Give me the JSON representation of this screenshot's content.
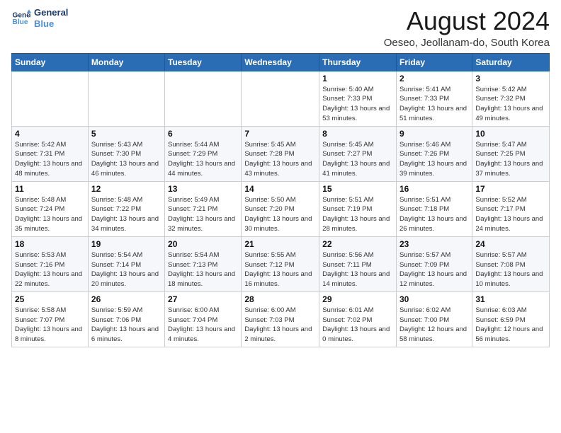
{
  "header": {
    "logo_line1": "General",
    "logo_line2": "Blue",
    "month_title": "August 2024",
    "subtitle": "Oeseo, Jeollanam-do, South Korea"
  },
  "weekdays": [
    "Sunday",
    "Monday",
    "Tuesday",
    "Wednesday",
    "Thursday",
    "Friday",
    "Saturday"
  ],
  "weeks": [
    [
      {
        "day": "",
        "sunrise": "",
        "sunset": "",
        "daylight": ""
      },
      {
        "day": "",
        "sunrise": "",
        "sunset": "",
        "daylight": ""
      },
      {
        "day": "",
        "sunrise": "",
        "sunset": "",
        "daylight": ""
      },
      {
        "day": "",
        "sunrise": "",
        "sunset": "",
        "daylight": ""
      },
      {
        "day": "1",
        "sunrise": "Sunrise: 5:40 AM",
        "sunset": "Sunset: 7:33 PM",
        "daylight": "Daylight: 13 hours and 53 minutes."
      },
      {
        "day": "2",
        "sunrise": "Sunrise: 5:41 AM",
        "sunset": "Sunset: 7:33 PM",
        "daylight": "Daylight: 13 hours and 51 minutes."
      },
      {
        "day": "3",
        "sunrise": "Sunrise: 5:42 AM",
        "sunset": "Sunset: 7:32 PM",
        "daylight": "Daylight: 13 hours and 49 minutes."
      }
    ],
    [
      {
        "day": "4",
        "sunrise": "Sunrise: 5:42 AM",
        "sunset": "Sunset: 7:31 PM",
        "daylight": "Daylight: 13 hours and 48 minutes."
      },
      {
        "day": "5",
        "sunrise": "Sunrise: 5:43 AM",
        "sunset": "Sunset: 7:30 PM",
        "daylight": "Daylight: 13 hours and 46 minutes."
      },
      {
        "day": "6",
        "sunrise": "Sunrise: 5:44 AM",
        "sunset": "Sunset: 7:29 PM",
        "daylight": "Daylight: 13 hours and 44 minutes."
      },
      {
        "day": "7",
        "sunrise": "Sunrise: 5:45 AM",
        "sunset": "Sunset: 7:28 PM",
        "daylight": "Daylight: 13 hours and 43 minutes."
      },
      {
        "day": "8",
        "sunrise": "Sunrise: 5:45 AM",
        "sunset": "Sunset: 7:27 PM",
        "daylight": "Daylight: 13 hours and 41 minutes."
      },
      {
        "day": "9",
        "sunrise": "Sunrise: 5:46 AM",
        "sunset": "Sunset: 7:26 PM",
        "daylight": "Daylight: 13 hours and 39 minutes."
      },
      {
        "day": "10",
        "sunrise": "Sunrise: 5:47 AM",
        "sunset": "Sunset: 7:25 PM",
        "daylight": "Daylight: 13 hours and 37 minutes."
      }
    ],
    [
      {
        "day": "11",
        "sunrise": "Sunrise: 5:48 AM",
        "sunset": "Sunset: 7:24 PM",
        "daylight": "Daylight: 13 hours and 35 minutes."
      },
      {
        "day": "12",
        "sunrise": "Sunrise: 5:48 AM",
        "sunset": "Sunset: 7:22 PM",
        "daylight": "Daylight: 13 hours and 34 minutes."
      },
      {
        "day": "13",
        "sunrise": "Sunrise: 5:49 AM",
        "sunset": "Sunset: 7:21 PM",
        "daylight": "Daylight: 13 hours and 32 minutes."
      },
      {
        "day": "14",
        "sunrise": "Sunrise: 5:50 AM",
        "sunset": "Sunset: 7:20 PM",
        "daylight": "Daylight: 13 hours and 30 minutes."
      },
      {
        "day": "15",
        "sunrise": "Sunrise: 5:51 AM",
        "sunset": "Sunset: 7:19 PM",
        "daylight": "Daylight: 13 hours and 28 minutes."
      },
      {
        "day": "16",
        "sunrise": "Sunrise: 5:51 AM",
        "sunset": "Sunset: 7:18 PM",
        "daylight": "Daylight: 13 hours and 26 minutes."
      },
      {
        "day": "17",
        "sunrise": "Sunrise: 5:52 AM",
        "sunset": "Sunset: 7:17 PM",
        "daylight": "Daylight: 13 hours and 24 minutes."
      }
    ],
    [
      {
        "day": "18",
        "sunrise": "Sunrise: 5:53 AM",
        "sunset": "Sunset: 7:16 PM",
        "daylight": "Daylight: 13 hours and 22 minutes."
      },
      {
        "day": "19",
        "sunrise": "Sunrise: 5:54 AM",
        "sunset": "Sunset: 7:14 PM",
        "daylight": "Daylight: 13 hours and 20 minutes."
      },
      {
        "day": "20",
        "sunrise": "Sunrise: 5:54 AM",
        "sunset": "Sunset: 7:13 PM",
        "daylight": "Daylight: 13 hours and 18 minutes."
      },
      {
        "day": "21",
        "sunrise": "Sunrise: 5:55 AM",
        "sunset": "Sunset: 7:12 PM",
        "daylight": "Daylight: 13 hours and 16 minutes."
      },
      {
        "day": "22",
        "sunrise": "Sunrise: 5:56 AM",
        "sunset": "Sunset: 7:11 PM",
        "daylight": "Daylight: 13 hours and 14 minutes."
      },
      {
        "day": "23",
        "sunrise": "Sunrise: 5:57 AM",
        "sunset": "Sunset: 7:09 PM",
        "daylight": "Daylight: 13 hours and 12 minutes."
      },
      {
        "day": "24",
        "sunrise": "Sunrise: 5:57 AM",
        "sunset": "Sunset: 7:08 PM",
        "daylight": "Daylight: 13 hours and 10 minutes."
      }
    ],
    [
      {
        "day": "25",
        "sunrise": "Sunrise: 5:58 AM",
        "sunset": "Sunset: 7:07 PM",
        "daylight": "Daylight: 13 hours and 8 minutes."
      },
      {
        "day": "26",
        "sunrise": "Sunrise: 5:59 AM",
        "sunset": "Sunset: 7:06 PM",
        "daylight": "Daylight: 13 hours and 6 minutes."
      },
      {
        "day": "27",
        "sunrise": "Sunrise: 6:00 AM",
        "sunset": "Sunset: 7:04 PM",
        "daylight": "Daylight: 13 hours and 4 minutes."
      },
      {
        "day": "28",
        "sunrise": "Sunrise: 6:00 AM",
        "sunset": "Sunset: 7:03 PM",
        "daylight": "Daylight: 13 hours and 2 minutes."
      },
      {
        "day": "29",
        "sunrise": "Sunrise: 6:01 AM",
        "sunset": "Sunset: 7:02 PM",
        "daylight": "Daylight: 13 hours and 0 minutes."
      },
      {
        "day": "30",
        "sunrise": "Sunrise: 6:02 AM",
        "sunset": "Sunset: 7:00 PM",
        "daylight": "Daylight: 12 hours and 58 minutes."
      },
      {
        "day": "31",
        "sunrise": "Sunrise: 6:03 AM",
        "sunset": "Sunset: 6:59 PM",
        "daylight": "Daylight: 12 hours and 56 minutes."
      }
    ]
  ]
}
